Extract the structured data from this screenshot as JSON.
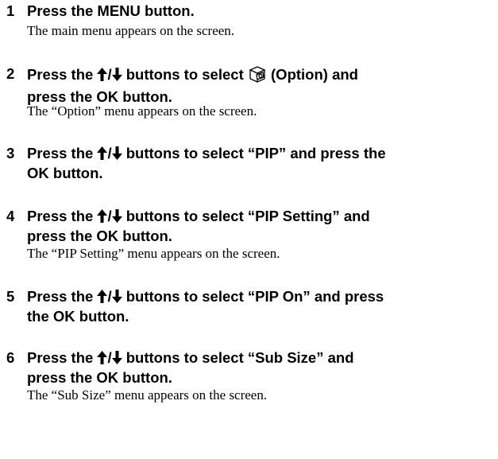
{
  "steps": [
    {
      "number": "1",
      "instruction": "Press the MENU button.",
      "result": "The main menu appears on the screen."
    },
    {
      "number": "2",
      "instruction_a": "Press the",
      "instruction_b": "buttons to select",
      "instruction_c": "(Option) and",
      "instruction_line2": "press the OK button.",
      "result": "The “Option” menu appears on the screen.",
      "icon": "option-icon"
    },
    {
      "number": "3",
      "instruction_a": "Press the",
      "instruction_b": "buttons to select “PIP” and press the",
      "instruction_line2": "OK button."
    },
    {
      "number": "4",
      "instruction_a": "Press the",
      "instruction_b": "buttons to select “PIP Setting” and",
      "instruction_line2": "press the OK button.",
      "result": "The “PIP Setting” menu appears on the screen."
    },
    {
      "number": "5",
      "instruction_a": "Press the",
      "instruction_b": "buttons to select “PIP On” and press",
      "instruction_line2": "the OK button."
    },
    {
      "number": "6",
      "instruction_a": "Press the",
      "instruction_b": "buttons to select “Sub Size” and",
      "instruction_line2": "press the OK button.",
      "result": "The “Sub Size” menu appears on the screen."
    }
  ],
  "up_down_icon": "up-down-arrow-icon",
  "slash": "/"
}
